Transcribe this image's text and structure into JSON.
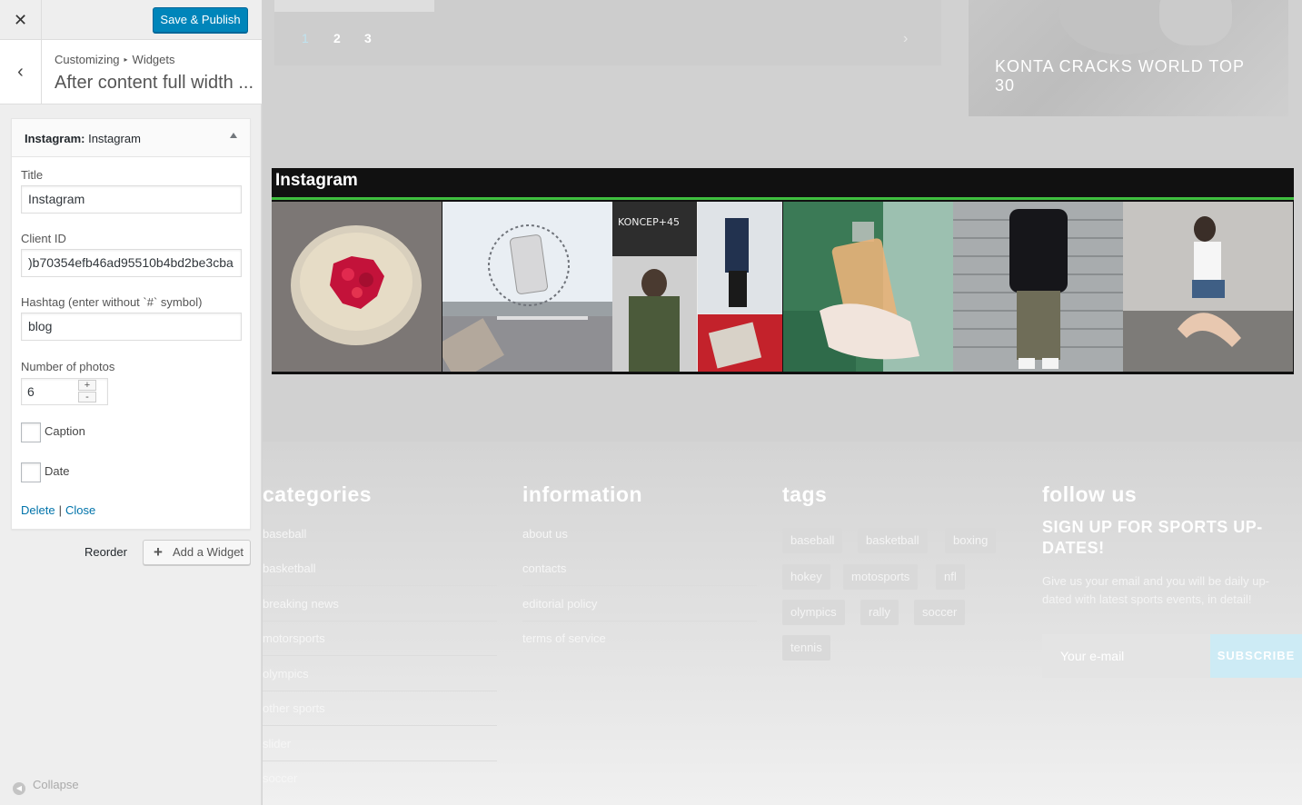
{
  "header": {
    "close_icon": "✕",
    "save_label": "Save & Publish"
  },
  "section": {
    "crumb_root": "Customizing",
    "crumb_child": "Widgets",
    "crumb_separator": "▸",
    "back_icon": "‹",
    "title": "After content full width ..."
  },
  "widget": {
    "type": "Instagram:",
    "name": "Instagram",
    "title_label": "Title",
    "title_value": "Instagram",
    "client_id_label": "Client ID",
    "client_id_value": ")b70354efb46ad95510b4bd2be3cba",
    "hashtag_label": "Hashtag (enter without `#` symbol)",
    "hashtag_value": "blog",
    "photos_label": "Number of photos",
    "photos_value": "6",
    "stepper_plus": "+",
    "stepper_minus": "-",
    "caption_label": "Caption",
    "date_label": "Date",
    "delete_label": "Delete",
    "link_separator": "|",
    "close_label": "Close"
  },
  "actions": {
    "reorder_label": "Reorder",
    "add_widget_icon": "+",
    "add_widget_label": "Add a Widget",
    "collapse_label": "Collapse",
    "collapse_icon": "◀"
  },
  "preview": {
    "pages": [
      "1",
      "2",
      "3"
    ],
    "next_icon": "›",
    "news_title": "KONTA CRACKS WORLD TOP 30",
    "instagram_title": "Instagram"
  },
  "footer": {
    "categories_heading": "categories",
    "categories": [
      "baseball",
      "basketball",
      "breaking news",
      "motorsports",
      "olympics",
      "other sports",
      "slider",
      "soccer"
    ],
    "information_heading": "information",
    "information": [
      "about us",
      "contacts",
      "editorial policy",
      "terms of service"
    ],
    "tags_heading": "tags",
    "tags": [
      "baseball",
      "basketball",
      "boxing",
      "hokey",
      "motosports",
      "nfl",
      "olympics",
      "rally",
      "soccer",
      "tennis"
    ],
    "follow_heading": "follow us",
    "signup_heading": "SIGN UP FOR SPORTS UP-DATES!",
    "signup_text": "Give us your email and you will be daily up-dated with latest sports events, in detail!",
    "email_placeholder": "Your e-mail",
    "subscribe_label": "SUBSCRIBE"
  },
  "colors": {
    "primary_button": "#0085ba",
    "link": "#0073aa",
    "instagram_accent": "#3fbf3f",
    "subscribe": "#cdebf5"
  }
}
